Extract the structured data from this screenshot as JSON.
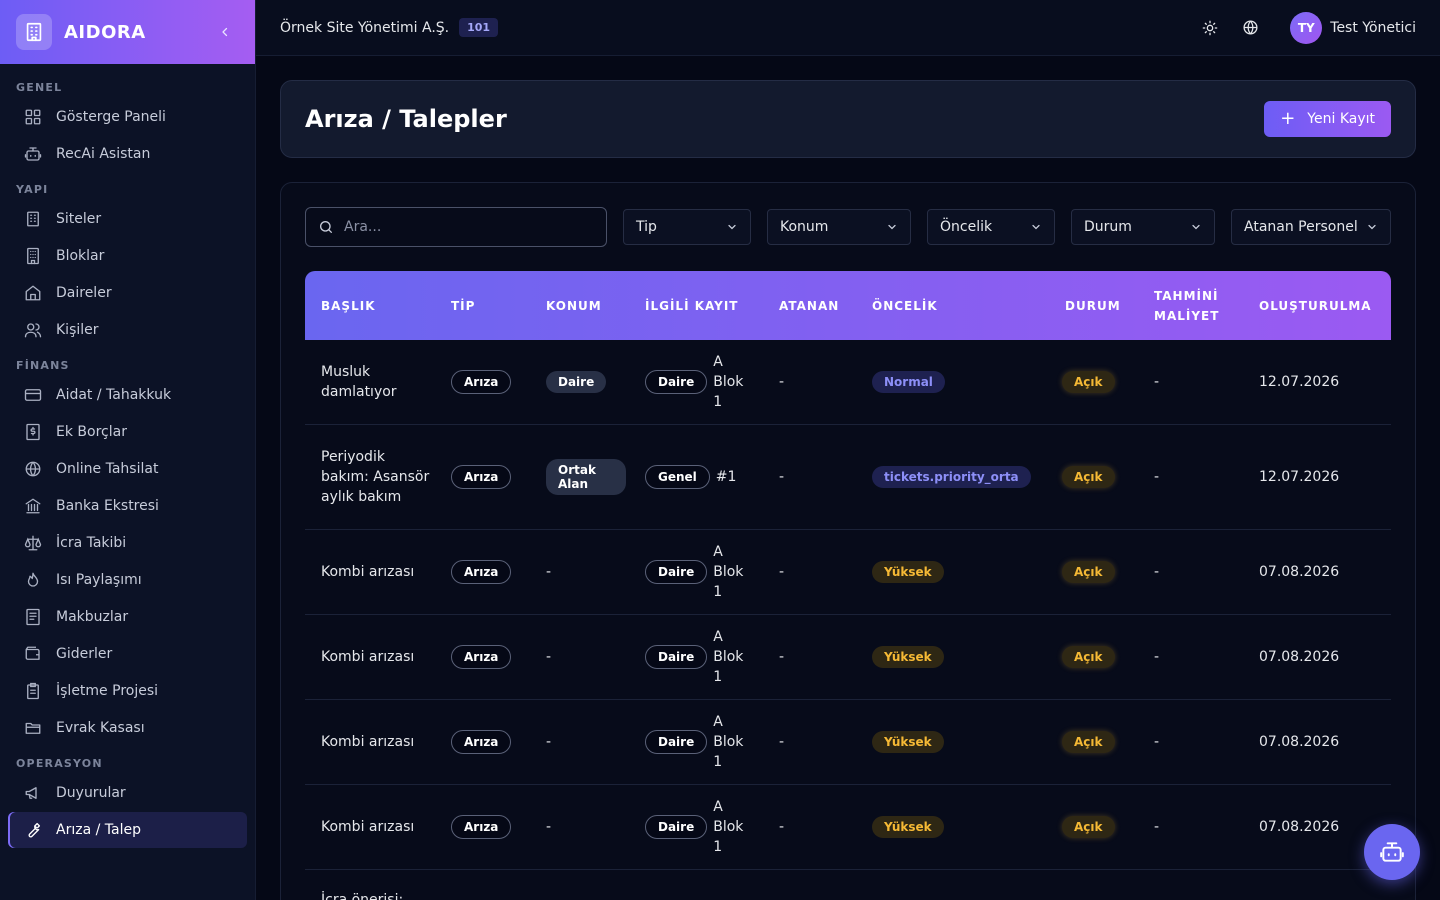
{
  "brand": {
    "name": "AIDORA"
  },
  "nav": {
    "sections": {
      "genel": "GENEL",
      "yapi": "YAPI",
      "finans": "FİNANS",
      "operasyon": "OPERASYON"
    },
    "items": {
      "dashboard": "Gösterge Paneli",
      "assistant": "RecAi Asistan",
      "sites": "Siteler",
      "blocks": "Bloklar",
      "flats": "Daireler",
      "people": "Kişiler",
      "dues": "Aidat / Tahakkuk",
      "extra_debts": "Ek Borçlar",
      "online_payment": "Online Tahsilat",
      "bank_statement": "Banka Ekstresi",
      "enforcement": "İcra Takibi",
      "heat_sharing": "Isı Paylaşımı",
      "receipts": "Makbuzlar",
      "expenses": "Giderler",
      "operating_plan": "İşletme Projesi",
      "documents": "Evrak Kasası",
      "announcements": "Duyurular",
      "tickets": "Arıza / Talep"
    }
  },
  "topbar": {
    "org_name": "Örnek Site Yönetimi A.Ş.",
    "org_badge": "101",
    "user_initials": "TY",
    "user_name": "Test Yönetici"
  },
  "page": {
    "title": "Arıza / Talepler",
    "new_button": "Yeni Kayıt"
  },
  "filters": {
    "search_placeholder": "Ara...",
    "type": "Tip",
    "location": "Konum",
    "priority": "Öncelik",
    "status": "Durum",
    "assignee": "Atanan Personel"
  },
  "table": {
    "headers": {
      "title": "BAŞLIK",
      "type": "TİP",
      "location": "KONUM",
      "related": "İLGİLİ KAYIT",
      "assigned": "ATANAN",
      "priority": "ÖNCELİK",
      "status": "DURUM",
      "cost": "TAHMİNİ MALİYET",
      "created": "OLUŞTURULMA"
    },
    "rows": [
      {
        "title": "Musluk damlatıyor",
        "type": "Arıza",
        "location": "Daire",
        "related_tag": "Daire",
        "related_text": "A Blok 1",
        "assigned": "-",
        "priority": "Normal",
        "status": "Açık",
        "cost": "-",
        "created": "12.07.2026"
      },
      {
        "title": "Periyodik bakım: Asansör aylık bakım",
        "type": "Arıza",
        "location": "Ortak Alan",
        "related_tag": "Genel",
        "related_text": "#1",
        "assigned": "-",
        "priority": "tickets.priority_orta",
        "status": "Açık",
        "cost": "-",
        "created": "12.07.2026"
      },
      {
        "title": "Kombi arızası",
        "type": "Arıza",
        "location": "-",
        "related_tag": "Daire",
        "related_text": "A Blok 1",
        "assigned": "-",
        "priority": "Yüksek",
        "status": "Açık",
        "cost": "-",
        "created": "07.08.2026"
      },
      {
        "title": "Kombi arızası",
        "type": "Arıza",
        "location": "-",
        "related_tag": "Daire",
        "related_text": "A Blok 1",
        "assigned": "-",
        "priority": "Yüksek",
        "status": "Açık",
        "cost": "-",
        "created": "07.08.2026"
      },
      {
        "title": "Kombi arızası",
        "type": "Arıza",
        "location": "-",
        "related_tag": "Daire",
        "related_text": "A Blok 1",
        "assigned": "-",
        "priority": "Yüksek",
        "status": "Açık",
        "cost": "-",
        "created": "07.08.2026"
      },
      {
        "title": "Kombi arızası",
        "type": "Arıza",
        "location": "-",
        "related_tag": "Daire",
        "related_text": "A Blok 1",
        "assigned": "-",
        "priority": "Yüksek",
        "status": "Açık",
        "cost": "-",
        "created": "07.08.2026"
      },
      {
        "title": "İcra önerisi:",
        "type": "",
        "location": "",
        "related_tag": "",
        "related_text": "",
        "assigned": "",
        "priority": "",
        "status": "",
        "cost": "",
        "created": ""
      }
    ]
  }
}
